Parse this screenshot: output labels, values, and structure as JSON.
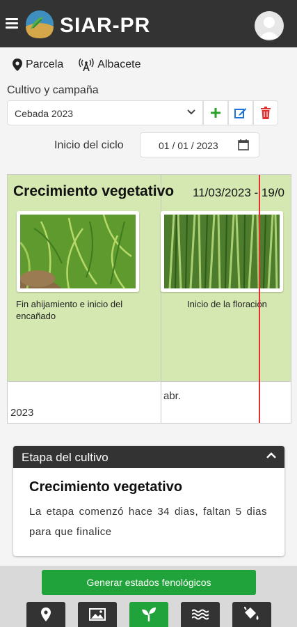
{
  "header": {
    "app_title": "SIAR-PR",
    "menu_icon": "hamburger-menu-icon",
    "logo_icon": "siar-logo-icon",
    "avatar_icon": "user-avatar-icon"
  },
  "location": {
    "parcela_label": "Parcela",
    "station_label": "Albacete",
    "parcela_icon": "map-pin-icon",
    "station_icon": "antenna-icon"
  },
  "crop": {
    "label": "Cultivo y campaña",
    "selected": "Cebada 2023",
    "start_label": "Inicio del ciclo",
    "start_date": "01 / 01 / 2023"
  },
  "timeline": {
    "phase_title": "Crecimiento vegetativo",
    "phase_dates": "11/03/2023 - 19/0",
    "photo1_caption": "Fin ahijamiento e inicio del encañado",
    "photo2_caption": "Inicio de la floración",
    "month_label": "abr.",
    "year_label": "2023"
  },
  "stage_card": {
    "header": "Etapa del cultivo",
    "title": "Crecimiento vegetativo",
    "description": "La etapa comenzó hace 34 dias, faltan 5 dias para que finalice"
  },
  "actions": {
    "generate_label": "Generar estados fenológicos"
  },
  "bottom_nav": [
    {
      "icon": "location-pin-icon",
      "active": false
    },
    {
      "icon": "image-icon",
      "active": false
    },
    {
      "icon": "sprout-icon",
      "active": true
    },
    {
      "icon": "water-waves-icon",
      "active": false
    },
    {
      "icon": "fertilizer-bucket-icon",
      "active": false
    }
  ],
  "colors": {
    "header_bg": "#333333",
    "accent_green": "#20a33a",
    "phase_bg": "#d5e8b2",
    "today_line": "#e23030",
    "delete_red": "#e0302f",
    "edit_blue": "#1e73d8"
  }
}
